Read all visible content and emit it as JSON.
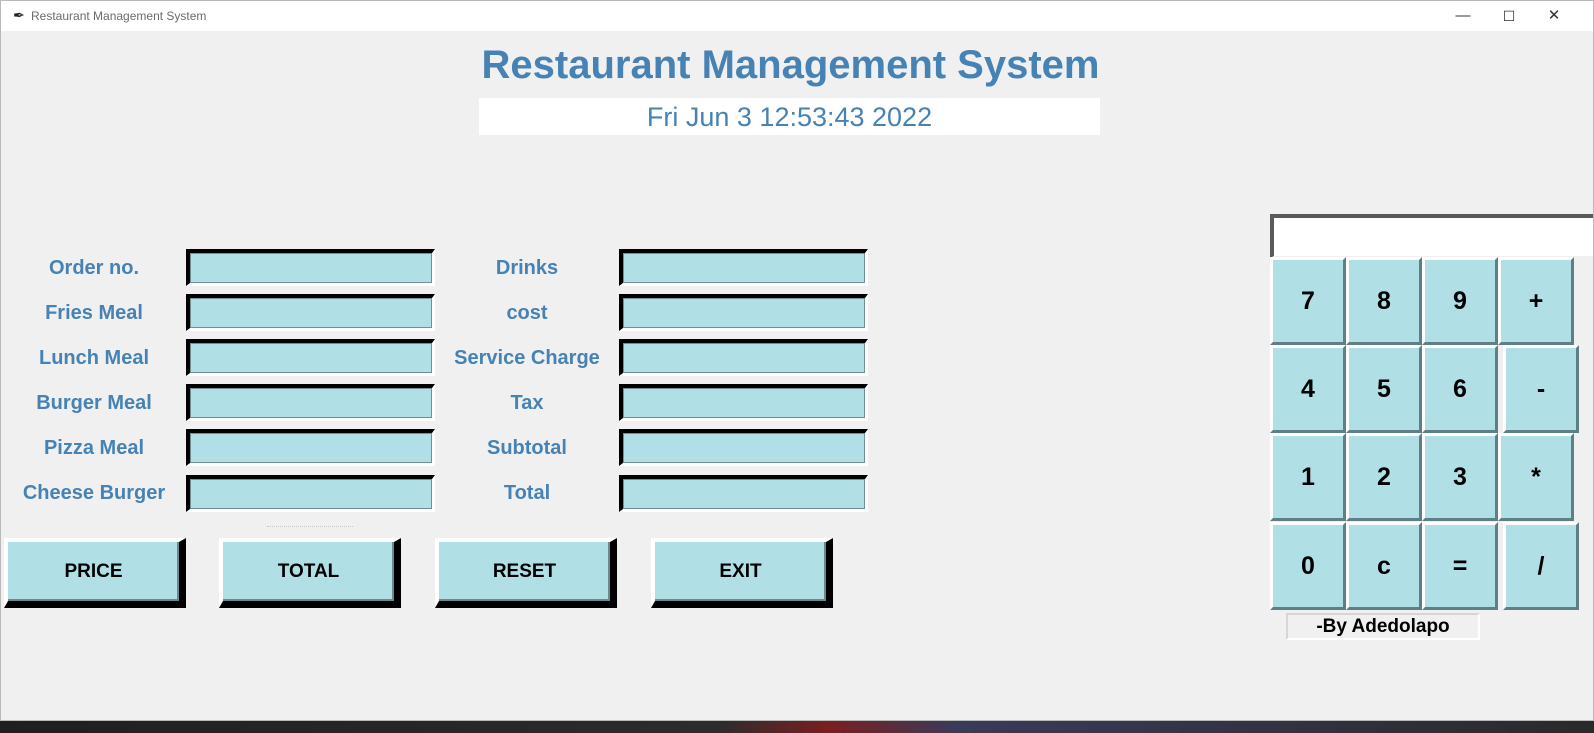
{
  "window": {
    "title": "Restaurant Management System",
    "controls": {
      "minimize": "—",
      "maximize": "☐",
      "close": "✕"
    }
  },
  "header": {
    "title": "Restaurant Management System",
    "datetime": "Fri Jun  3 12:53:43 2022"
  },
  "form": {
    "left_labels": [
      "Order no.",
      "Fries Meal",
      "Lunch Meal",
      "Burger Meal",
      "Pizza Meal",
      "Cheese Burger"
    ],
    "right_labels": [
      "Drinks",
      "cost",
      "Service Charge",
      "Tax",
      "Subtotal",
      "Total"
    ],
    "left_values": [
      "",
      "",
      "",
      "",
      "",
      ""
    ],
    "right_values": [
      "",
      "",
      "",
      "",
      "",
      ""
    ]
  },
  "buttons": {
    "price": "PRICE",
    "total": "TOTAL",
    "reset": "RESET",
    "exit": "EXIT"
  },
  "calculator": {
    "display_value": "",
    "keys": [
      "7",
      "8",
      "9",
      "+",
      "4",
      "5",
      "6",
      "-",
      "1",
      "2",
      "3",
      "*",
      "0",
      "c",
      "=",
      "/"
    ],
    "credit": "-By Adedolapo"
  },
  "colors": {
    "heading": "#4682b4",
    "entry_bg": "#b0e0e6",
    "window_bg": "#f0f0f0"
  }
}
